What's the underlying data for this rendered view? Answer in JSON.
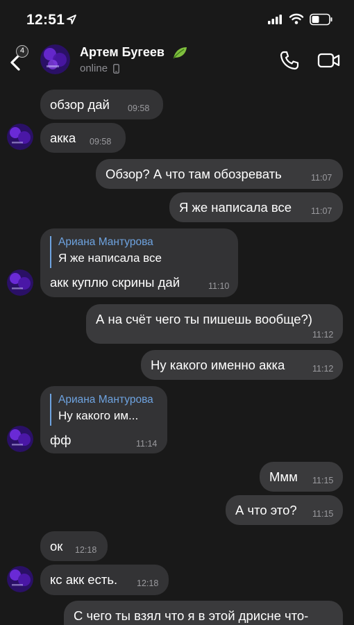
{
  "status": {
    "time": "12:51"
  },
  "header": {
    "back_badge": "4",
    "name": "Артем Бугеев",
    "presence": "online"
  },
  "messages": [
    {
      "text": "обзор дай",
      "time": "09:58"
    },
    {
      "text": "акка",
      "time": "09:58"
    },
    {
      "text": "Обзор? А что там обозревать",
      "time": "11:07"
    },
    {
      "text": "Я же написала все",
      "time": "11:07"
    },
    {
      "reply_name": "Ариана Мантурова",
      "reply_text": "Я же написала все",
      "text": "акк куплю скрины дай",
      "time": "11:10"
    },
    {
      "text": "А на счёт чего ты пишешь вообще?)",
      "time": "11:12"
    },
    {
      "text": "Ну какого именно акка",
      "time": "11:12"
    },
    {
      "reply_name": "Ариана Мантурова",
      "reply_text": "Ну какого им...",
      "text": "фф",
      "time": "11:14"
    },
    {
      "text": "Ммм",
      "time": "11:15"
    },
    {
      "text": "А что это?",
      "time": "11:15"
    },
    {
      "text": "ок",
      "time": "12:18"
    },
    {
      "text": "кс акк есть.",
      "time": "12:18"
    },
    {
      "text": "С чего ты взял что я в этой дрисне что-"
    }
  ],
  "colors": {
    "background": "#191919",
    "bubble": "#333335",
    "reply_accent": "#6ea3e0"
  },
  "icons": [
    "location-arrow-icon",
    "signal-icon",
    "wifi-icon",
    "battery-icon",
    "back-chevron-icon",
    "leaf-icon",
    "phone-icon",
    "video-camera-icon",
    "mobile-device-icon"
  ]
}
